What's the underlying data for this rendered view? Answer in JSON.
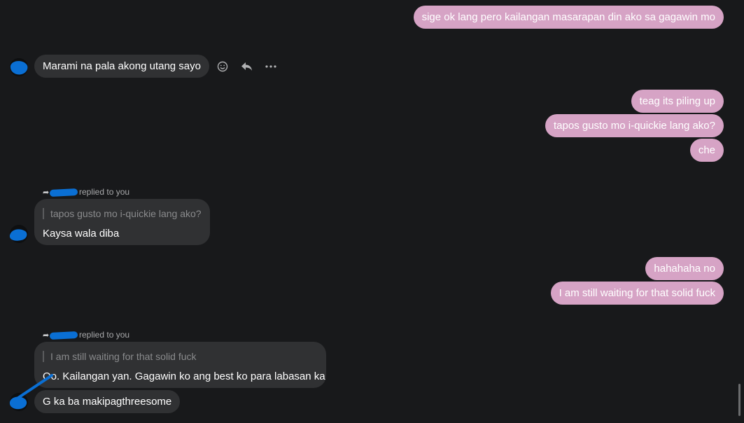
{
  "colors": {
    "background": "#18191b",
    "outgoing_bubble": "#d6a3c5",
    "incoming_bubble": "#303133",
    "redaction": "#0a6fd4"
  },
  "messages": {
    "out_1": "sige ok lang pero kailangan masarapan din ako sa gagawin mo",
    "in_1": "Marami na pala akong utang sayo",
    "out_2": "teag its piling up",
    "out_3": "tapos gusto mo i-quickie lang ako?",
    "out_4": "che",
    "out_5": "hahahaha no",
    "out_6": "I am still waiting for that solid fuck",
    "in_4": "G ka ba makipagthreesome"
  },
  "replies": [
    {
      "replied_label": "replied to you",
      "quoted": "tapos gusto mo i-quickie lang ako?",
      "text": "Kaysa wala diba"
    },
    {
      "replied_label": "replied to you",
      "quoted": "I am still waiting for that solid fuck",
      "text": "Oo. Kailangan yan. Gagawin ko ang best ko para labasan ka"
    }
  ],
  "toolbar_icons": [
    "emoji-reaction-icon",
    "reply-icon",
    "more-options-icon"
  ]
}
